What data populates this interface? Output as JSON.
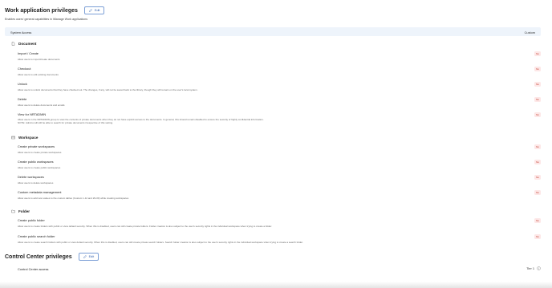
{
  "work_section": {
    "title": "Work application privileges",
    "edit_label": "Edit",
    "description": "Enables users' general capabilities in iManage Work applications"
  },
  "table_header": {
    "left": "System Access",
    "right": "Custom"
  },
  "groups": [
    {
      "title": "Document",
      "icon": "document-icon",
      "items": [
        {
          "name": "Import / Create",
          "desc": "Allow users to import/create documents",
          "badge": "No"
        },
        {
          "name": "Checkout",
          "desc": "Allow users to edit existing documents",
          "badge": "No"
        },
        {
          "name": "Unlock",
          "desc": "Allow users to unlock documents that they have checked out. The changes, if any, will not be saved back to the library, though they will remain on the user's local system.",
          "badge": "No"
        },
        {
          "name": "Delete",
          "desc": "Allow users to delete documents and emails",
          "badge": "No"
        },
        {
          "name": "View for NRTADMIN",
          "desc": "Allow users in the NRTADMIN group to view the contents of private documents when they do not have explicit access to the documents. In general, this should remain disabled to ensure the security of highly confidential information.",
          "desc2": "NOTE: Admins will still be able to search for private documents irrespective of this setting.",
          "badge": "No"
        }
      ]
    },
    {
      "title": "Workspace",
      "icon": "workspace-icon",
      "items": [
        {
          "name": "Create private workspaces",
          "desc": "Allow users to create private workspaces",
          "badge": "No"
        },
        {
          "name": "Create public workspaces",
          "desc": "Allow users to create public workspaces",
          "badge": "No"
        },
        {
          "name": "Delete workspaces",
          "desc": "Allow users to delete workspaces",
          "badge": "No"
        },
        {
          "name": "Custom metadata management",
          "desc": "Allow users to add new values to the custom tables (Custom 1-12 and 29-30) while creating workspaces",
          "badge": "No"
        }
      ]
    },
    {
      "title": "Folder",
      "icon": "folder-icon",
      "items": [
        {
          "name": "Create public folder",
          "desc": "Allow users to create folders with public or view default security. When this is disabled, users can still create private folders. Folder creation is also subject to the user's security rights in the individual workspace when trying to create a folder.",
          "badge": "No"
        },
        {
          "name": "Create public search folder",
          "desc": "Allow users to create search folders with public or view default security. When this is disabled, users can still create private search folders. Search folder creation is also subject to the user's security rights in the individual workspace when trying to create a search folder.",
          "badge": "No"
        }
      ]
    }
  ],
  "control_section": {
    "title": "Control Center privileges",
    "edit_label": "Edit",
    "item": "Control Center access",
    "tier": "Tier 1"
  },
  "colors": {
    "badge_bg": "#fde7e7",
    "badge_text": "#c0392b",
    "header_bg": "#eef4fb",
    "edit_border": "#7c9fd6"
  }
}
